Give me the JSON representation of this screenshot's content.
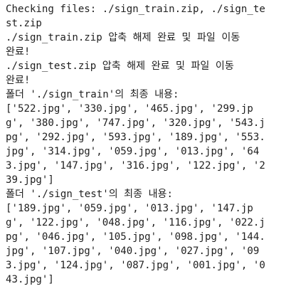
{
  "output": {
    "lines": [
      "Checking files: ./sign_train.zip, ./sign_te",
      "st.zip",
      "./sign_train.zip 압축 해제 완료 및 파일 이동",
      "완료!",
      "./sign_test.zip 압축 해제 완료 및 파일 이동",
      "완료!",
      "폴더 './sign_train'의 최종 내용:",
      "['522.jpg', '330.jpg', '465.jpg', '299.jp",
      "g', '380.jpg', '747.jpg', '320.jpg', '543.j",
      "pg', '292.jpg', '593.jpg', '189.jpg', '553.",
      "jpg', '314.jpg', '059.jpg', '013.jpg', '64",
      "3.jpg', '147.jpg', '316.jpg', '122.jpg', '2",
      "39.jpg']",
      "폴더 './sign_test'의 최종 내용:",
      "['189.jpg', '059.jpg', '013.jpg', '147.jp",
      "g', '122.jpg', '048.jpg', '116.jpg', '022.j",
      "pg', '046.jpg', '105.jpg', '098.jpg', '144.",
      "jpg', '107.jpg', '040.jpg', '027.jpg', '09",
      "3.jpg', '124.jpg', '087.jpg', '001.jpg', '0",
      "43.jpg']"
    ]
  }
}
